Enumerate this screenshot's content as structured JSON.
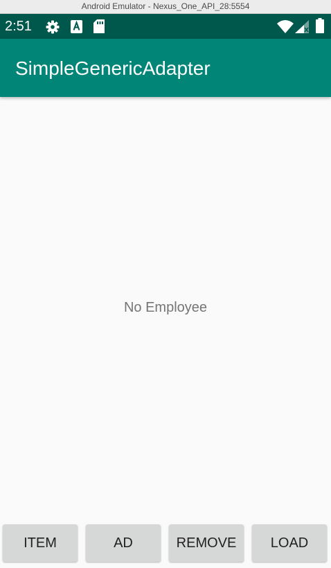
{
  "window": {
    "title": "Android Emulator - Nexus_One_API_28:5554"
  },
  "status_bar": {
    "time": "2:51",
    "icons": [
      "settings-icon",
      "a-accessibility-icon",
      "sd-card-icon",
      "wifi-icon",
      "cell-signal-icon",
      "battery-icon"
    ],
    "background": "#00574b"
  },
  "app_bar": {
    "title": "SimpleGenericAdapter",
    "background": "#008577"
  },
  "content": {
    "empty_text": "No Employee"
  },
  "buttons": {
    "item": "ITEM",
    "ad": "AD",
    "remove": "REMOVE",
    "load": "LOAD"
  }
}
